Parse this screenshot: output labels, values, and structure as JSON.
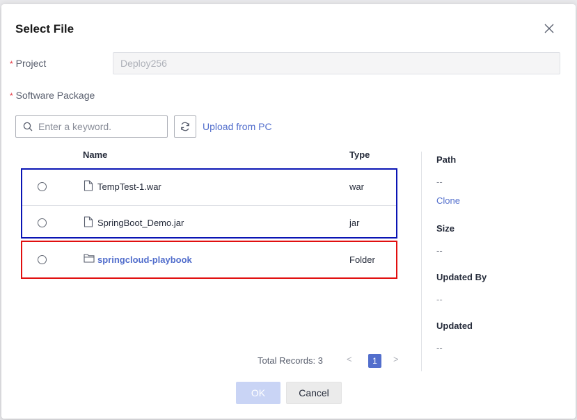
{
  "dialog": {
    "title": "Select File",
    "close_icon": "close-icon"
  },
  "form": {
    "project_required": "*",
    "project_label": "Project",
    "project_value": "Deploy256",
    "package_required": "*",
    "package_label": "Software Package"
  },
  "toolbar": {
    "search_placeholder": "Enter a keyword.",
    "search_icon": "search-icon",
    "refresh_icon": "refresh-icon",
    "upload_label": "Upload from PC"
  },
  "table": {
    "columns": [
      "Name",
      "Type"
    ],
    "rows": [
      {
        "name": "TempTest-1.war",
        "type": "war",
        "icon": "file-icon"
      },
      {
        "name": "SpringBoot_Demo.jar",
        "type": "jar",
        "icon": "file-icon"
      },
      {
        "name": "springcloud-playbook",
        "type": "Folder",
        "icon": "folder-icon"
      }
    ]
  },
  "details": {
    "path_label": "Path",
    "path_value": "--",
    "clone_label": "Clone",
    "size_label": "Size",
    "size_value": "--",
    "updated_by_label": "Updated By",
    "updated_by_value": "--",
    "updated_label": "Updated",
    "updated_value": "--"
  },
  "pagination": {
    "total_label": "Total Records: 3",
    "prev": "<",
    "current_page": "1",
    "next": ">"
  },
  "footer": {
    "ok_label": "OK",
    "cancel_label": "Cancel"
  },
  "colors": {
    "accent": "#526ecc",
    "highlight_blue": "#0a14b4",
    "highlight_red": "#e10f0f",
    "required": "#e4343f"
  }
}
